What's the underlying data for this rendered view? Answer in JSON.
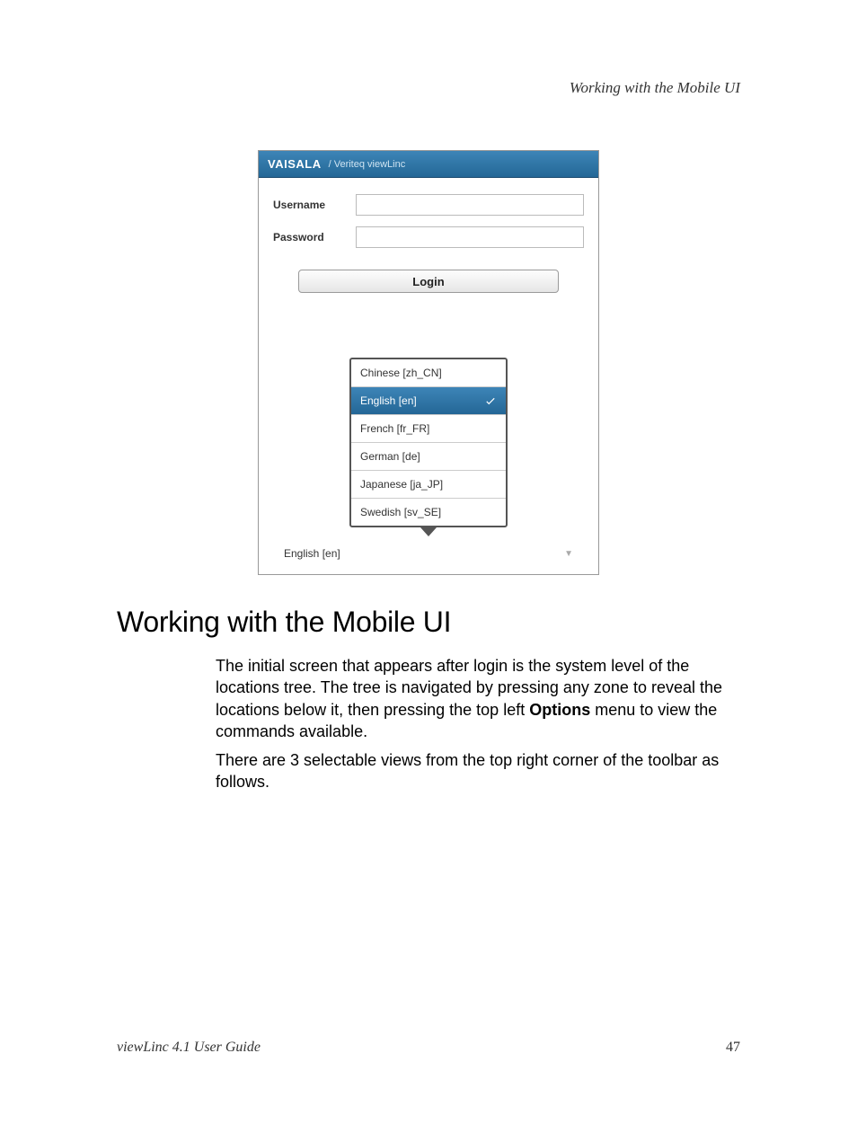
{
  "running_head": "Working with the Mobile UI",
  "mobile": {
    "brand": "VAISALA",
    "brand_sub": "/ Veriteq viewLinc",
    "username_label": "Username",
    "password_label": "Password",
    "login_btn": "Login",
    "languages": [
      {
        "label": "Chinese [zh_CN]",
        "selected": false
      },
      {
        "label": "English [en]",
        "selected": true
      },
      {
        "label": "French [fr_FR]",
        "selected": false
      },
      {
        "label": "German [de]",
        "selected": false
      },
      {
        "label": "Japanese [ja_JP]",
        "selected": false
      },
      {
        "label": "Swedish [sv_SE]",
        "selected": false
      }
    ],
    "selected_language": "English [en]"
  },
  "heading": "Working with the Mobile UI",
  "body": {
    "p1a": "The initial screen that appears after login is the system level of the locations tree.  The tree is navigated by pressing any zone to reveal the locations below it, then pressing the top left ",
    "p1_bold": "Options",
    "p1b": " menu to view the commands available.",
    "p2": "There are 3 selectable views from the top right corner of the toolbar as follows."
  },
  "footer": {
    "left": "viewLinc 4.1 User Guide",
    "right": "47"
  }
}
